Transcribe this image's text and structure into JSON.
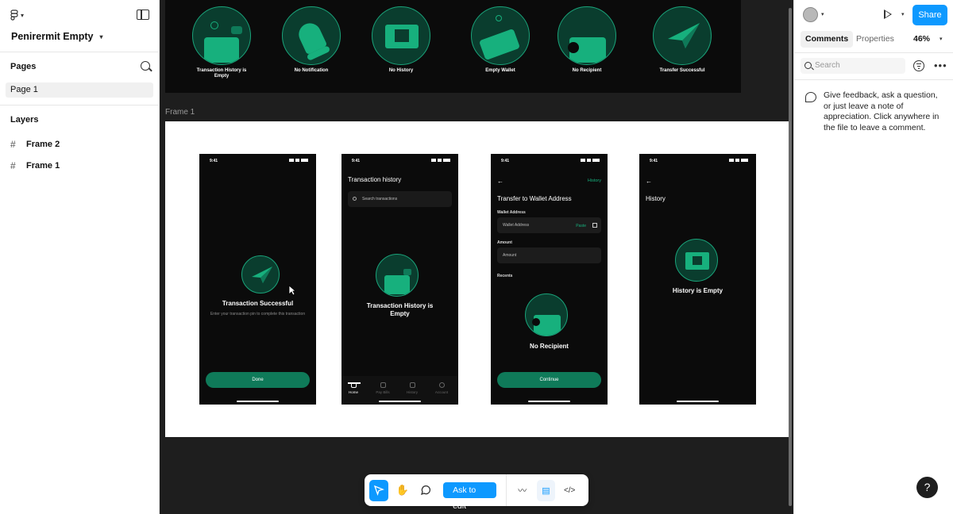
{
  "left_panel": {
    "project_name": "Penirermit Empty",
    "pages_heading": "Pages",
    "pages": [
      "Page 1"
    ],
    "layers_heading": "Layers",
    "layers": [
      "Frame 2",
      "Frame 1"
    ]
  },
  "canvas": {
    "frame_label": "Frame 1",
    "illustrations": [
      {
        "label": "Transaction History is Empty"
      },
      {
        "label": "No Notification"
      },
      {
        "label": "No History"
      },
      {
        "label": "Empty Wallet"
      },
      {
        "label": "No Recipient"
      },
      {
        "label": "Transfer Successful"
      }
    ],
    "phones": {
      "status_time": "9:41",
      "success": {
        "title": "Transaction Successful",
        "subtitle": "Enter your transaction pin to complete this transaction",
        "button": "Done"
      },
      "history": {
        "heading": "Transaction history",
        "search_placeholder": "Search transactions",
        "title": "Transaction History is Empty",
        "tabs": [
          "Home",
          "Pay Bills",
          "History",
          "Account"
        ]
      },
      "transfer": {
        "history_link": "History",
        "heading": "Transfer to Wallet Address",
        "wallet_label": "Wallet Address",
        "wallet_placeholder": "Wallet Address",
        "paste": "Paste",
        "amount_label": "Amount",
        "amount_placeholder": "Amount",
        "recents": "Recents",
        "empty_title": "No Recipient",
        "button": "Continue"
      },
      "history_empty": {
        "heading": "History",
        "title": "History is Empty"
      }
    }
  },
  "toolbar": {
    "ask_to_edit": "Ask to edit"
  },
  "right_panel": {
    "share": "Share",
    "tabs": [
      "Comments",
      "Properties"
    ],
    "zoom": "46%",
    "search_placeholder": "Search",
    "feedback_text": "Give feedback, ask a question, or just leave a note of appreciation. Click anywhere in the file to leave a comment.",
    "help": "?"
  },
  "colors": {
    "accent": "#0d99ff",
    "brand_green": "#0f7a59",
    "illustration_green": "#17b07d"
  }
}
